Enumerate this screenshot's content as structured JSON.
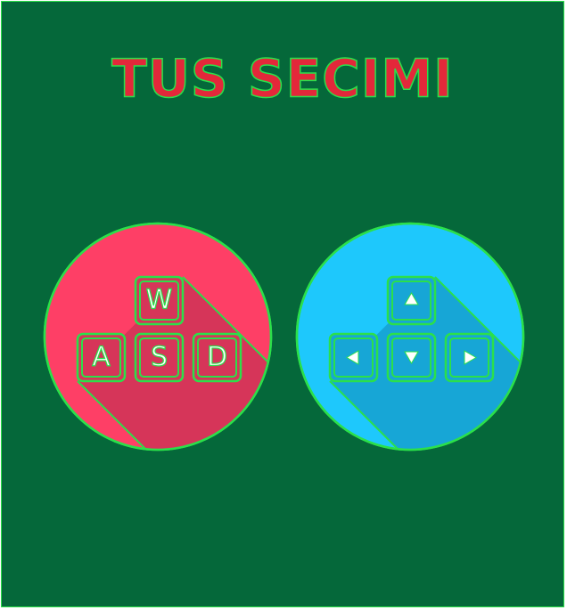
{
  "title": "TUS SECIMI",
  "options": [
    {
      "id": "wasd",
      "keys": [
        "W",
        "A",
        "S",
        "D"
      ],
      "color": "#fe3f66"
    },
    {
      "id": "arrows",
      "keys": [
        "up-arrow-icon",
        "left-arrow-icon",
        "down-arrow-icon",
        "right-arrow-icon"
      ],
      "color": "#1ec8fc"
    }
  ],
  "colors": {
    "background": "#05683a",
    "accent_green": "#2be04a",
    "title_red": "#e3283a",
    "wasd_circle": "#fe3f66",
    "wasd_shadow": "#d63559",
    "arrows_circle": "#1ec8fc",
    "arrows_shadow": "#17a6d6"
  }
}
